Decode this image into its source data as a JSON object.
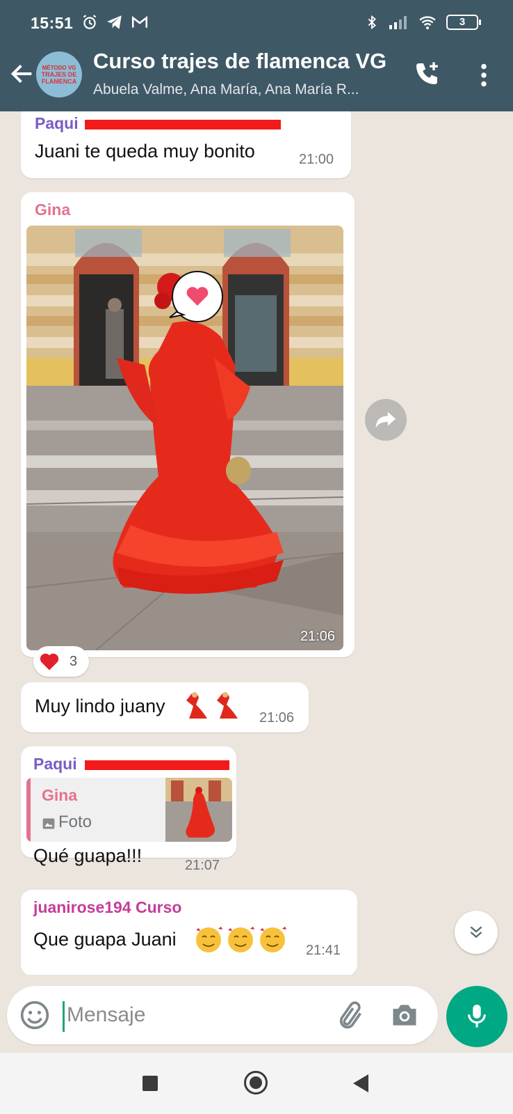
{
  "status_bar": {
    "time": "15:51",
    "battery": "3"
  },
  "header": {
    "title": "Curso trajes de flamenca VG",
    "subtitle": "Abuela Valme, Ana María, Ana María R...",
    "avatar_text": [
      "MÉTODO VG",
      "TRAJES DE",
      "FLAMENCA"
    ]
  },
  "messages": [
    {
      "sender": "Paqui",
      "text": "Juani te queda muy bonito",
      "time": "21:00"
    },
    {
      "sender": "Gina",
      "type": "photo",
      "time": "21:06",
      "reaction": {
        "emoji": "❤",
        "count": "3"
      }
    },
    {
      "text": "Muy lindo juany",
      "time": "21:06"
    },
    {
      "sender": "Paqui",
      "quote": {
        "sender": "Gina",
        "label": "Foto"
      },
      "text": "Qué guapa!!!",
      "time": "21:07"
    },
    {
      "sender": "juanirose194 Curso",
      "text": "Que guapa Juani",
      "time": "21:41"
    }
  ],
  "input": {
    "placeholder": "Mensaje"
  },
  "colors": {
    "header_bg": "#3F5865",
    "chat_bg": "#ECE5DD",
    "paqui": "#7B5BC6",
    "gina": "#E4738E",
    "juanirose": "#C53D9A",
    "accent": "#00A884"
  }
}
